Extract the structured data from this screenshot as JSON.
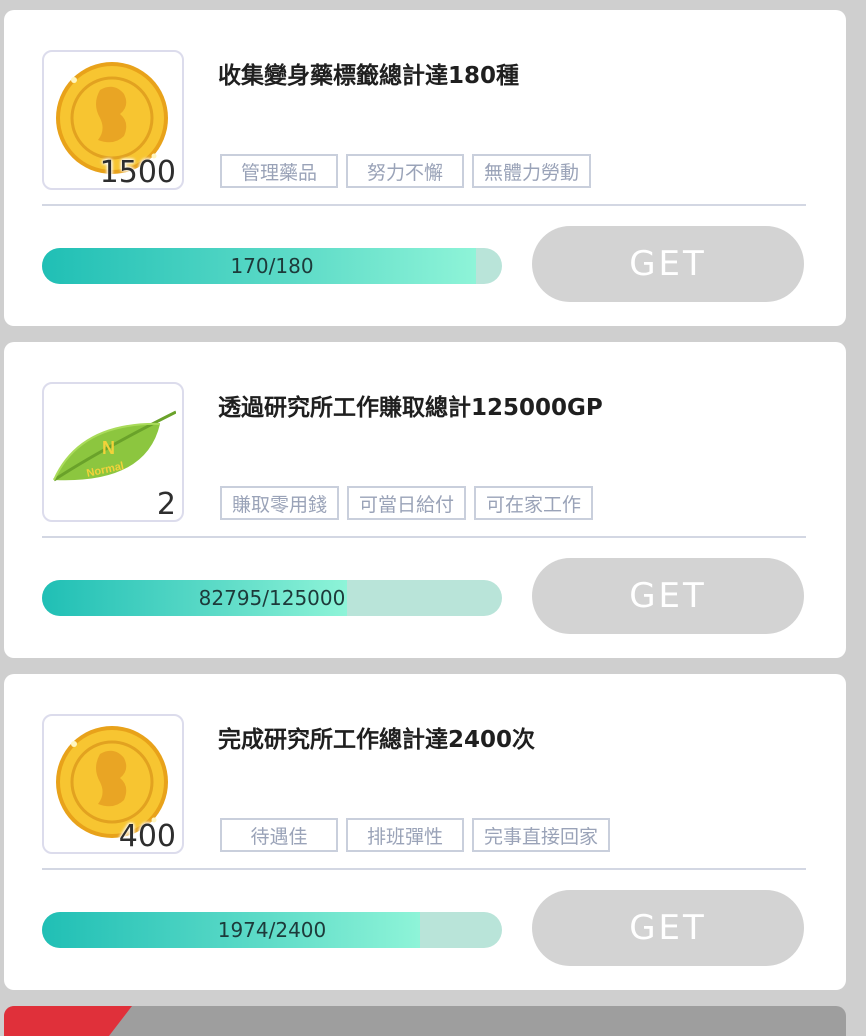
{
  "missions": [
    {
      "title": "收集變身藥標籤總計達180種",
      "reward_icon": "gold-coin-icon",
      "reward_count": "1500",
      "tags": [
        "管理藥品",
        "努力不懈",
        "無體力勞動"
      ],
      "progress_text": "170/180",
      "progress_fraction": 0.944,
      "button_label": "GET"
    },
    {
      "title": "透過研究所工作賺取總計125000GP",
      "reward_icon": "green-leaf-icon",
      "reward_count": "2",
      "tags": [
        "賺取零用錢",
        "可當日給付",
        "可在家工作"
      ],
      "progress_text": "82795/125000",
      "progress_fraction": 0.662,
      "button_label": "GET"
    },
    {
      "title": "完成研究所工作總計達2400次",
      "reward_icon": "gold-coin-icon",
      "reward_count": "400",
      "tags": [
        "待遇佳",
        "排班彈性",
        "完事直接回家"
      ],
      "progress_text": "1974/2400",
      "progress_fraction": 0.8225,
      "button_label": "GET"
    }
  ],
  "colors": {
    "progress_fill": "#20bfb5",
    "progress_track": "#b9e4d9",
    "button_disabled": "#d3d3d3",
    "tag_border": "#c9cfdc",
    "bottom_accent": "#e0303a"
  }
}
